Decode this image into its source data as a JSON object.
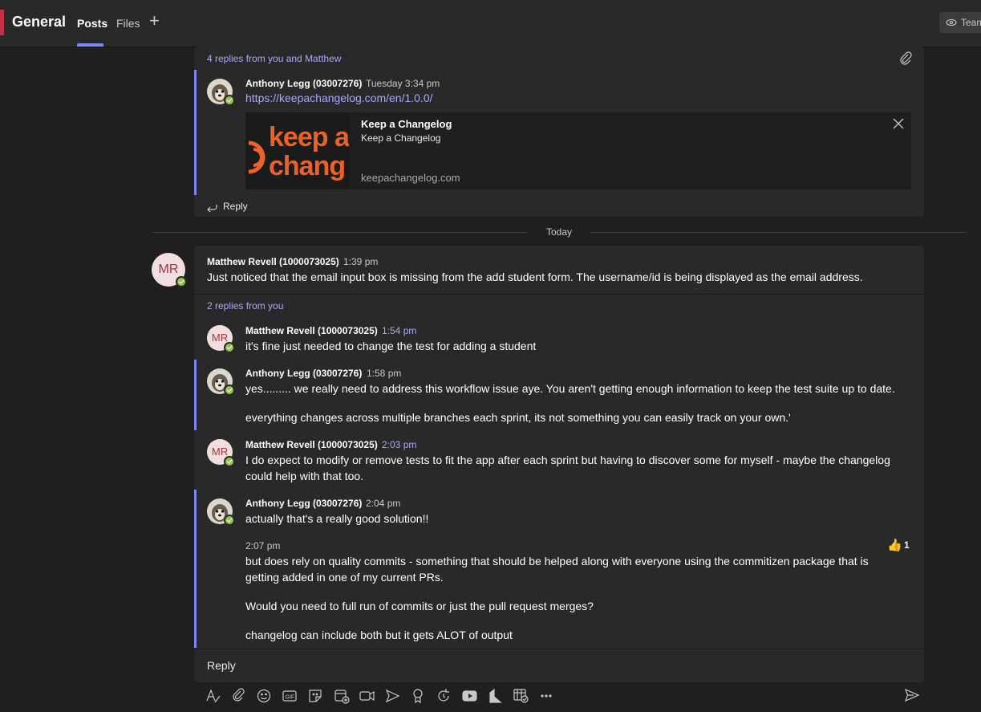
{
  "header": {
    "channel_title": "General",
    "tabs": [
      {
        "label": "Posts",
        "active": true
      },
      {
        "label": "Files",
        "active": false
      }
    ],
    "add_tab_icon": "plus-icon",
    "team_button_label": "Team",
    "team_button_icon": "eye-icon"
  },
  "thread1": {
    "replies_link": "4 replies from you and Matthew",
    "attachment_icon": "paperclip-icon",
    "reply": {
      "author": "Anthony Legg (03007276)",
      "time": "Tuesday 3:34 pm",
      "link": "https://keepachangelog.com/en/1.0.0/",
      "preview": {
        "title": "Keep a Changelog",
        "subtitle": "Keep a Changelog",
        "domain": "keepachangelog.com",
        "thumb_line1": "keep a",
        "thumb_line2": "chang",
        "close_icon": "close-icon"
      }
    },
    "reply_button": "Reply"
  },
  "date_divider": "Today",
  "thread2": {
    "root": {
      "author": "Matthew Revell (1000073025)",
      "initials": "MR",
      "time": "1:39 pm",
      "text": "Just noticed that the email input box is missing from the add student form. The username/id is being displayed as the email address."
    },
    "replies_link": "2 replies from you",
    "replies": [
      {
        "author": "Matthew Revell (1000073025)",
        "initials": "MR",
        "time": "1:54 pm",
        "text": "it's fine just needed to change the test for adding a student"
      },
      {
        "author": "Anthony Legg (03007276)",
        "time": "1:58 pm",
        "text1": "yes......... we really need to address this workflow issue aye. You aren't getting enough information to keep the test suite up to date.",
        "text2": "everything changes across multiple branches each sprint, its not something you can easily track on your own.'"
      },
      {
        "author": "Matthew Revell (1000073025)",
        "initials": "MR",
        "time": "2:03 pm",
        "text1": "I do expect to modify or remove tests to fit the app after each sprint but having to discover some for myself - maybe the changelog",
        "text2": "could help with that too."
      },
      {
        "author": "Anthony Legg (03007276)",
        "time": "2:04 pm",
        "text": "actually that's a really good solution!!",
        "followup_time": "2:07 pm",
        "followup_line1": "but does rely on quality commits - something that should be helped along with everyone using the commitizen package that is",
        "followup_line2": "getting added in one of my current PRs.",
        "followup_line3": "Would you need to full run of commits or just the pull request merges?",
        "followup_line4": "changelog can include both but it gets ALOT of output",
        "reaction_icon": "thumbs-up-icon",
        "reaction_count": "1"
      }
    ],
    "reply_box": "Reply"
  },
  "compose_toolbar": {
    "icons": [
      "format-icon",
      "attach-icon",
      "emoji-icon",
      "gif-icon",
      "sticker-icon",
      "meet-icon",
      "video-icon",
      "stream-icon",
      "praise-icon",
      "loop-icon",
      "youtube-icon",
      "approvals-icon",
      "forms-icon",
      "more-icon"
    ],
    "send_icon": "send-icon"
  },
  "colors": {
    "accent": "#7f85f5",
    "link": "#a6a7ff",
    "presence": "#92c353",
    "brand_orange": "#e8622a"
  }
}
